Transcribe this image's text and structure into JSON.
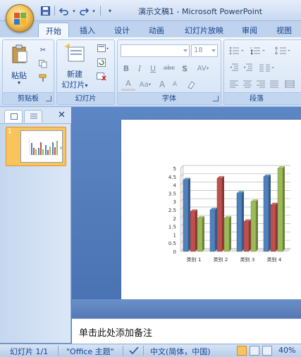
{
  "app": {
    "title": "演示文稿1 - Microsoft PowerPoint"
  },
  "quick_access": {
    "save_icon": "save-icon",
    "undo_icon": "undo-icon",
    "redo_icon": "redo-icon",
    "customize_icon": "chevron-down-icon"
  },
  "ribbon_tabs": [
    {
      "label": "开始",
      "active": true
    },
    {
      "label": "插入"
    },
    {
      "label": "设计"
    },
    {
      "label": "动画"
    },
    {
      "label": "幻灯片放映"
    },
    {
      "label": "审阅"
    },
    {
      "label": "视图"
    }
  ],
  "ribbon": {
    "clipboard": {
      "group_label": "剪贴板",
      "paste_label": "粘贴"
    },
    "slides": {
      "group_label": "幻灯片",
      "new_slide_label_line1": "新建",
      "new_slide_label_line2": "幻灯片"
    },
    "font": {
      "group_label": "字体",
      "font_size": "18",
      "bold": "B",
      "italic": "I",
      "underline": "U",
      "strike": "abc",
      "shadow": "S",
      "spacing": "AV",
      "font_color": "A",
      "change_case": "Aa",
      "grow": "A",
      "shrink": "A"
    },
    "paragraph": {
      "group_label": "段落"
    }
  },
  "left_panel": {
    "slide_number": "1"
  },
  "chart_data": {
    "type": "bar",
    "categories": [
      "类别 1",
      "类别 2",
      "类别 3",
      "类别 4"
    ],
    "series": [
      {
        "values": [
          4.3,
          2.5,
          3.5,
          4.5
        ],
        "color": "#4f81bd"
      },
      {
        "values": [
          2.4,
          4.4,
          1.8,
          2.8
        ],
        "color": "#c0504d"
      },
      {
        "values": [
          2.0,
          2.0,
          3.0,
          5.0
        ],
        "color": "#9bbb59"
      }
    ],
    "yticks": [
      "0",
      "0.5",
      "1",
      "1.5",
      "2",
      "2.5",
      "3",
      "3.5",
      "4",
      "4.5",
      "5"
    ],
    "ylim": [
      0,
      5
    ],
    "grid": true
  },
  "notes": {
    "placeholder": "单击此处添加备注"
  },
  "status_bar": {
    "slide_info": "幻灯片 1/1",
    "theme": "\"Office 主题\"",
    "language": "中文(简体，中国)",
    "zoom": "40%"
  }
}
